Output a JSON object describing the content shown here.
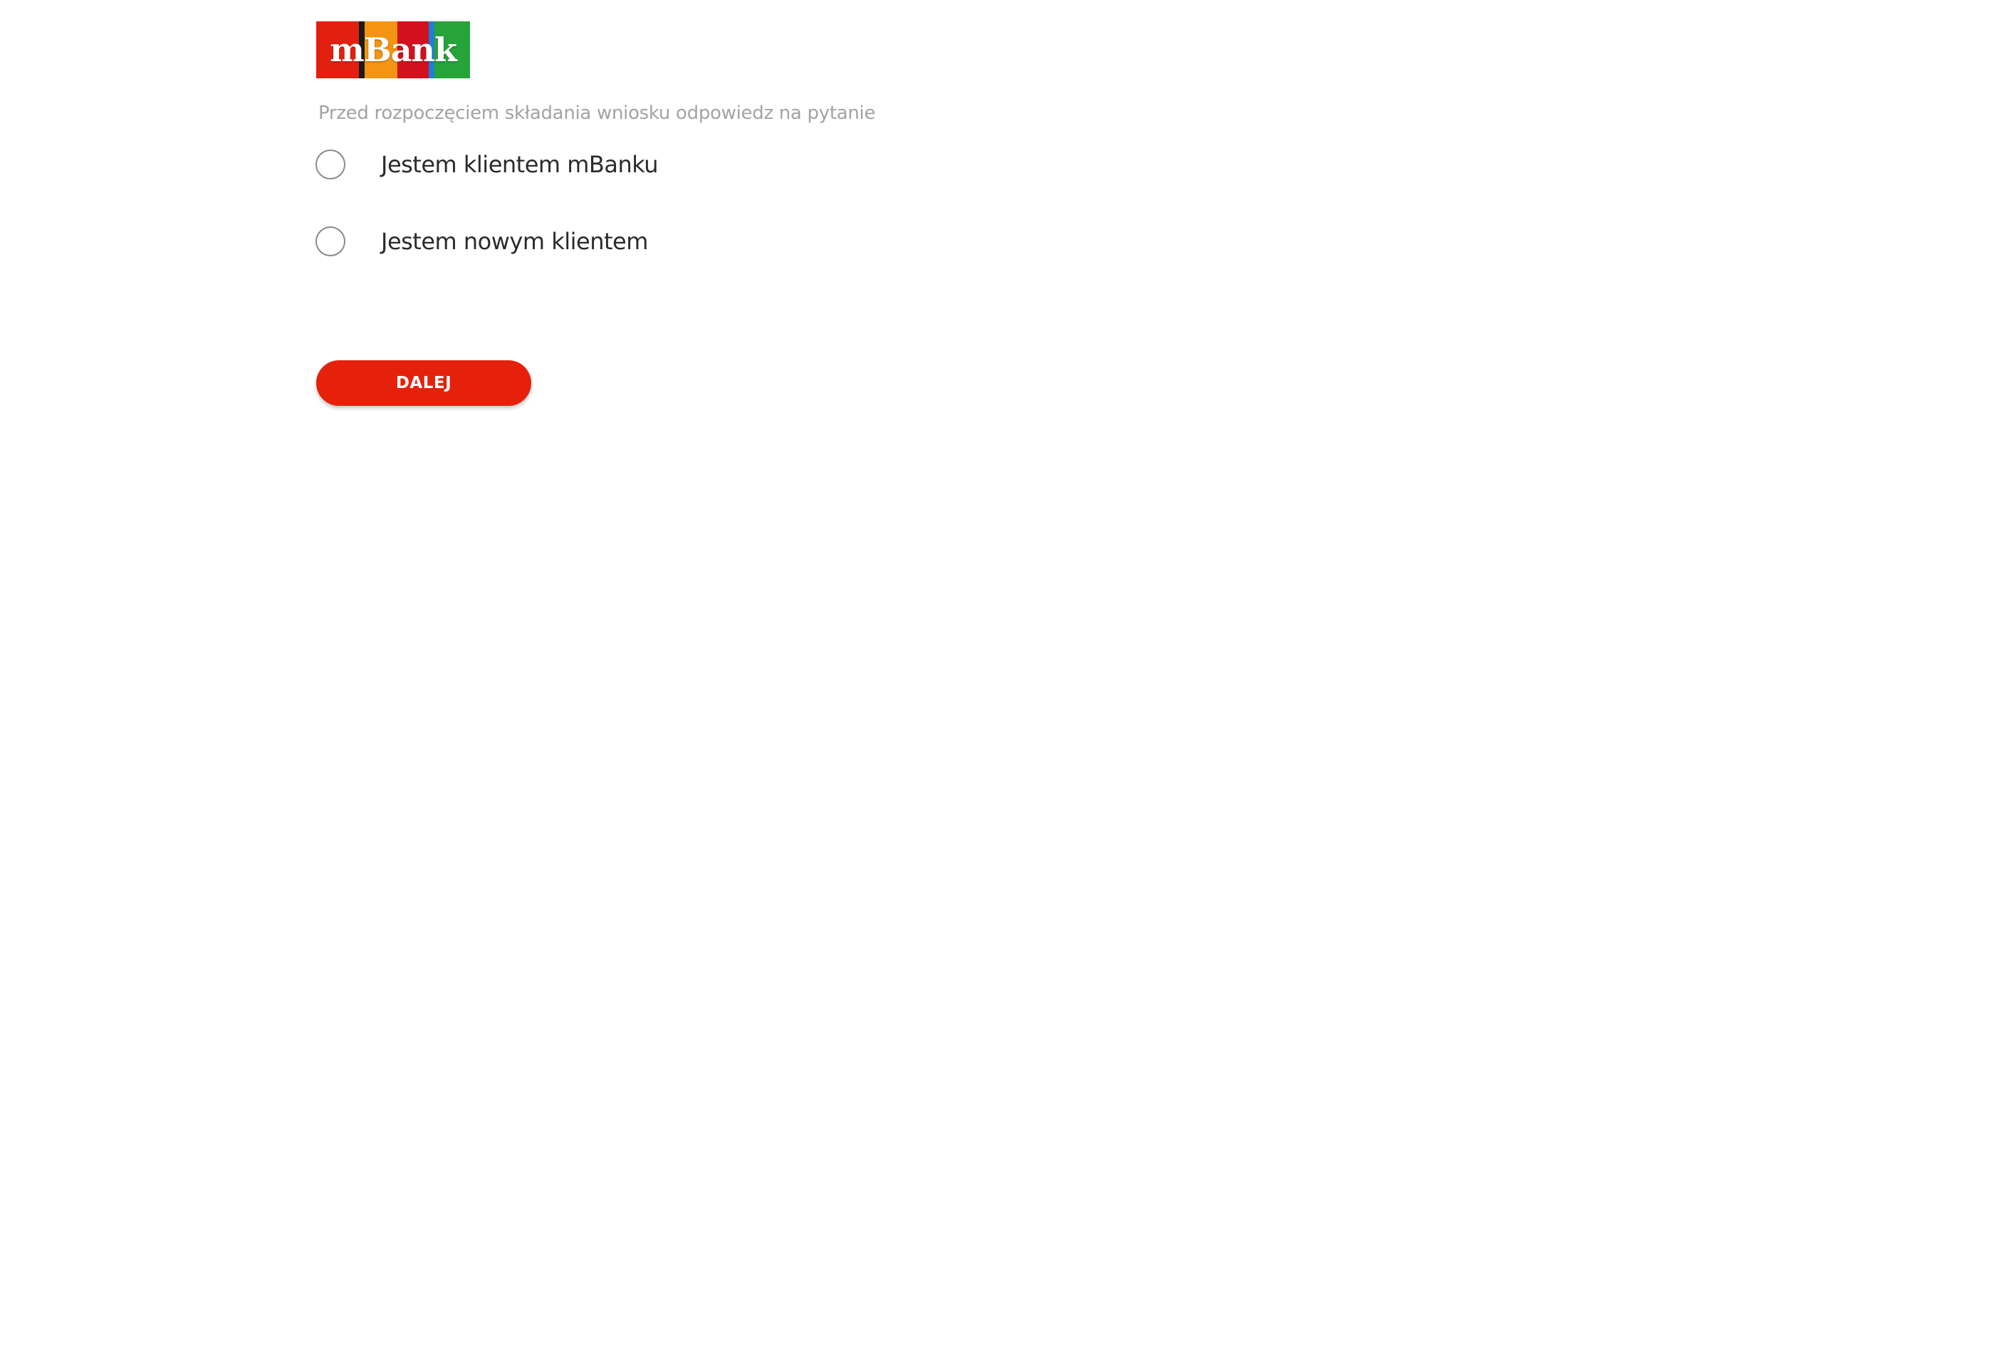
{
  "brand": {
    "logo_text": "mBank",
    "colors": {
      "red": "#e3200f",
      "orange": "#f39512",
      "dark_red": "#d3111e",
      "blue": "#1f7ed6",
      "green": "#26a43a",
      "black": "#1b1b1b"
    }
  },
  "form": {
    "prompt": "Przed rozpoczęciem składania wniosku odpowiedz na pytanie",
    "options": [
      {
        "label": "Jestem klientem mBanku",
        "selected": false
      },
      {
        "label": "Jestem nowym klientem",
        "selected": false
      }
    ],
    "next_button_label": "DALEJ",
    "accent_color": "#e5210c"
  }
}
